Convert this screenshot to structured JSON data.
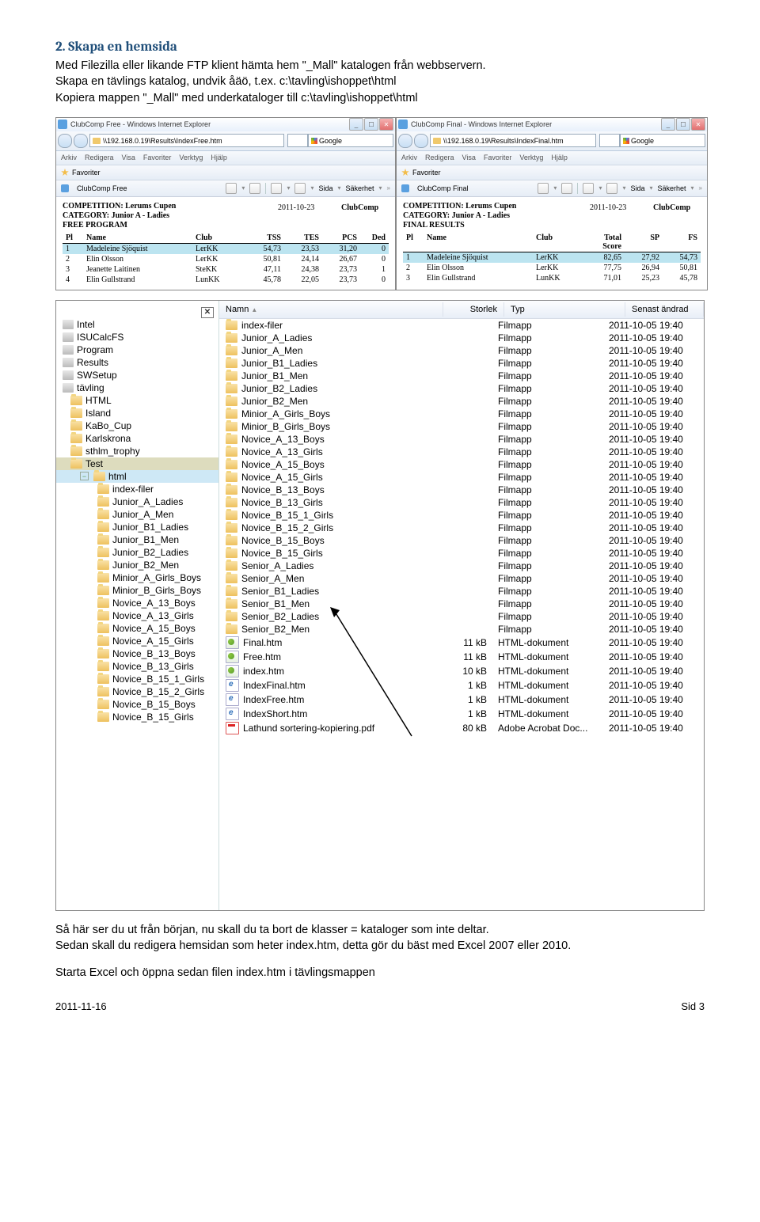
{
  "heading": "2. Skapa en hemsida",
  "para1a": "Med Filezilla eller likande FTP klient hämta hem \"_Mall\" katalogen från webbservern.",
  "para1b": "Skapa en tävlings katalog, undvik åäö, t.ex. c:\\tavling\\ishoppet\\html",
  "para1c": "Kopiera mappen \"_Mall\" med underkataloger till c:\\tavling\\ishoppet\\html",
  "para2a": "Så här ser du ut från början, nu skall du ta bort de klasser = kataloger som inte deltar.",
  "para2b": "Sedan skall du redigera hemsidan som heter index.htm, detta gör du bäst med Excel 2007 eller 2010.",
  "para3": "Starta Excel och öppna sedan filen index.htm i tävlingsmappen",
  "ie": {
    "left": {
      "title": "ClubComp Free - Windows Internet Explorer",
      "addr": "\\\\192.168.0.19\\Results\\IndexFree.htm",
      "search": "Google",
      "menu": [
        "Arkiv",
        "Redigera",
        "Visa",
        "Favoriter",
        "Verktyg",
        "Hjälp"
      ],
      "fav": "Favoriter",
      "tab": "ClubComp Free",
      "sida": "Sida",
      "sakerhet": "Säkerhet",
      "comp": "COMPETITION: Lerums Cupen",
      "cat": "CATEGORY: Junior A - Ladies",
      "prog": "FREE PROGRAM",
      "date": "2011-10-23",
      "brand": "ClubComp",
      "cols": [
        "Pl",
        "Name",
        "Club",
        "TSS",
        "TES",
        "PCS",
        "Ded"
      ],
      "rows": [
        [
          "1",
          "Madeleine Sjöquist",
          "LerKK",
          "54,73",
          "23,53",
          "31,20",
          "0"
        ],
        [
          "2",
          "Elin Olsson",
          "LerKK",
          "50,81",
          "24,14",
          "26,67",
          "0"
        ],
        [
          "3",
          "Jeanette Laitinen",
          "SteKK",
          "47,11",
          "24,38",
          "23,73",
          "1"
        ],
        [
          "4",
          "Elin Gullstrand",
          "LunKK",
          "45,78",
          "22,05",
          "23,73",
          "0"
        ]
      ]
    },
    "right": {
      "title": "ClubComp Final - Windows Internet Explorer",
      "addr": "\\\\192.168.0.19\\Results\\IndexFinal.htm",
      "search": "Google",
      "menu": [
        "Arkiv",
        "Redigera",
        "Visa",
        "Favoriter",
        "Verktyg",
        "Hjälp"
      ],
      "fav": "Favoriter",
      "tab": "ClubComp Final",
      "sida": "Sida",
      "sakerhet": "Säkerhet",
      "comp": "COMPETITION: Lerums Cupen",
      "cat": "CATEGORY: Junior A - Ladies",
      "prog": "FINAL RESULTS",
      "date": "2011-10-23",
      "brand": "ClubComp",
      "cols": [
        "Pl",
        "Name",
        "Club",
        "Total Score",
        "SP",
        "FS"
      ],
      "rows": [
        [
          "1",
          "Madeleine Sjöquist",
          "LerKK",
          "82,65",
          "27,92",
          "54,73"
        ],
        [
          "2",
          "Elin Olsson",
          "LerKK",
          "77,75",
          "26,94",
          "50,81"
        ],
        [
          "3",
          "Elin Gullstrand",
          "LunKK",
          "71,01",
          "25,23",
          "45,78"
        ]
      ]
    }
  },
  "explorer": {
    "headers": {
      "name": "Namn",
      "size": "Storlek",
      "type": "Typ",
      "date": "Senast ändrad"
    },
    "leftTop": [
      "Intel",
      "ISUCalcFS",
      "Program",
      "Results",
      "SWSetup",
      "tävling"
    ],
    "leftFolders": [
      "HTML",
      "Island",
      "KaBo_Cup",
      "Karlskrona",
      "sthlm_trophy",
      "Test"
    ],
    "htmlSel": "html",
    "leftSub": [
      "index-filer",
      "Junior_A_Ladies",
      "Junior_A_Men",
      "Junior_B1_Ladies",
      "Junior_B1_Men",
      "Junior_B2_Ladies",
      "Junior_B2_Men",
      "Minior_A_Girls_Boys",
      "Minior_B_Girls_Boys",
      "Novice_A_13_Boys",
      "Novice_A_13_Girls",
      "Novice_A_15_Boys",
      "Novice_A_15_Girls",
      "Novice_B_13_Boys",
      "Novice_B_13_Girls",
      "Novice_B_15_1_Girls",
      "Novice_B_15_2_Girls",
      "Novice_B_15_Boys",
      "Novice_B_15_Girls"
    ],
    "folders": [
      "index-filer",
      "Junior_A_Ladies",
      "Junior_A_Men",
      "Junior_B1_Ladies",
      "Junior_B1_Men",
      "Junior_B2_Ladies",
      "Junior_B2_Men",
      "Minior_A_Girls_Boys",
      "Minior_B_Girls_Boys",
      "Novice_A_13_Boys",
      "Novice_A_13_Girls",
      "Novice_A_15_Boys",
      "Novice_A_15_Girls",
      "Novice_B_13_Boys",
      "Novice_B_13_Girls",
      "Novice_B_15_1_Girls",
      "Novice_B_15_2_Girls",
      "Novice_B_15_Boys",
      "Novice_B_15_Girls",
      "Senior_A_Ladies",
      "Senior_A_Men",
      "Senior_B1_Ladies",
      "Senior_B1_Men",
      "Senior_B2_Ladies",
      "Senior_B2_Men"
    ],
    "folderType": "Filmapp",
    "folderDate": "2011-10-05 19:40",
    "files": [
      {
        "name": "Final.htm",
        "size": "11 kB",
        "type": "HTML-dokument",
        "date": "2011-10-05 19:40",
        "icon": "htm"
      },
      {
        "name": "Free.htm",
        "size": "11 kB",
        "type": "HTML-dokument",
        "date": "2011-10-05 19:40",
        "icon": "htm"
      },
      {
        "name": "index.htm",
        "size": "10 kB",
        "type": "HTML-dokument",
        "date": "2011-10-05 19:40",
        "icon": "htm"
      },
      {
        "name": "IndexFinal.htm",
        "size": "1 kB",
        "type": "HTML-dokument",
        "date": "2011-10-05 19:40",
        "icon": "ie"
      },
      {
        "name": "IndexFree.htm",
        "size": "1 kB",
        "type": "HTML-dokument",
        "date": "2011-10-05 19:40",
        "icon": "ie"
      },
      {
        "name": "IndexShort.htm",
        "size": "1 kB",
        "type": "HTML-dokument",
        "date": "2011-10-05 19:40",
        "icon": "ie"
      },
      {
        "name": "Lathund sortering-kopiering.pdf",
        "size": "80 kB",
        "type": "Adobe Acrobat Doc...",
        "date": "2011-10-05 19:40",
        "icon": "pdf"
      }
    ]
  },
  "footer": {
    "date": "2011-11-16",
    "page": "Sid 3"
  }
}
